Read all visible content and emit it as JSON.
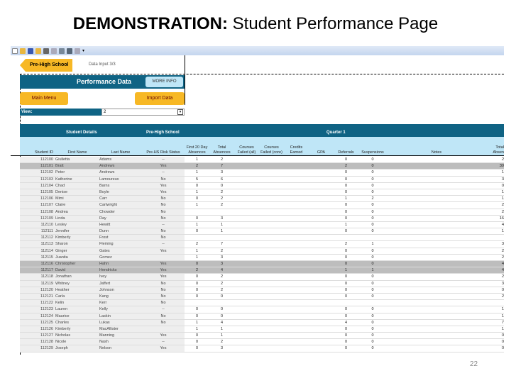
{
  "slide": {
    "title_bold": "DEMONSTRATION:",
    "title_rest": " Student Performance Page",
    "page_number": "22"
  },
  "nav": {
    "pre_high_school": "Pre-High School",
    "data_input": "Data Input 3/3"
  },
  "header": {
    "title": "Performance Data",
    "more_info": "MORE INFO",
    "main_menu": "Main Menu",
    "import_data": "Import Data",
    "view_label": "View:",
    "view_value": "2"
  },
  "groups": {
    "student_details": "Student Details",
    "pre_high_school": "Pre-High School",
    "quarter": "Quarter 1"
  },
  "columns": [
    "Student ID",
    "First Name",
    "Last Name",
    "Pre-HS Risk Status",
    "First 20 Day Absences",
    "Total Absences",
    "Courses Failed (all)",
    "Courses Failed (core)",
    "Credits Earned",
    "GPA",
    "Referrals",
    "Suspensions",
    "Notes",
    "Total Absen"
  ],
  "rows": [
    [
      "112100",
      "Giulietta",
      "Adams",
      "--",
      "1",
      "2",
      "0",
      "0",
      "2",
      false
    ],
    [
      "112101",
      "Bratt",
      "Andrews",
      "Yes",
      "2",
      "7",
      "2",
      "0",
      "30",
      true
    ],
    [
      "112102",
      "Peter",
      "Andrews",
      "--",
      "1",
      "3",
      "0",
      "0",
      "1",
      false
    ],
    [
      "112103",
      "Katherine",
      "Lamoureux",
      "No",
      "5",
      "6",
      "0",
      "0",
      "3",
      false
    ],
    [
      "112104",
      "Chad",
      "Barns",
      "Yes",
      "0",
      "0",
      "0",
      "0",
      "0",
      false
    ],
    [
      "112105",
      "Denise",
      "Boyle",
      "Yes",
      "1",
      "2",
      "0",
      "0",
      "1",
      false
    ],
    [
      "112106",
      "Mimi",
      "Carr",
      "No",
      "0",
      "2",
      "1",
      "2",
      "1",
      false
    ],
    [
      "112107",
      "Claire",
      "Cartwright",
      "No",
      "1",
      "2",
      "0",
      "0",
      "2",
      false
    ],
    [
      "112108",
      "Andrea",
      "Chowder",
      "No",
      "",
      "",
      "0",
      "0",
      "2",
      false
    ],
    [
      "112109",
      "Linda",
      "Day",
      "No",
      "0",
      "3",
      "0",
      "0",
      "16",
      false
    ],
    [
      "112110",
      "Lesley",
      "Hewitt",
      "--",
      "1",
      "1",
      "1",
      "0",
      "4",
      false
    ],
    [
      "112111",
      "Jennifer",
      "Dunn",
      "No",
      "0",
      "1",
      "0",
      "0",
      "1",
      false
    ],
    [
      "112112",
      "Kimberly",
      "Frost",
      "No",
      "",
      "",
      "",
      "",
      "",
      false
    ],
    [
      "112113",
      "Sharon",
      "Fleming",
      "--",
      "2",
      "7",
      "2",
      "1",
      "3",
      false
    ],
    [
      "112114",
      "Ginger",
      "Gates",
      "Yes",
      "1",
      "2",
      "0",
      "0",
      "2",
      false
    ],
    [
      "112115",
      "Juanita",
      "Gomez",
      "",
      "1",
      "3",
      "0",
      "0",
      "2",
      false
    ],
    [
      "112116",
      "Christopher",
      "Hahn",
      "Yes",
      "0",
      "3",
      "0",
      "0",
      "4",
      true
    ],
    [
      "112117",
      "David",
      "Hendricks",
      "Yes",
      "2",
      "4",
      "1",
      "1",
      "4",
      true
    ],
    [
      "112118",
      "Jonathan",
      "Ivey",
      "Yes",
      "0",
      "2",
      "0",
      "0",
      "2",
      false
    ],
    [
      "112119",
      "Whitney",
      "Jaffert",
      "No",
      "0",
      "2",
      "0",
      "0",
      "3",
      false
    ],
    [
      "112120",
      "Heather",
      "Johnson",
      "No",
      "0",
      "2",
      "0",
      "0",
      "0",
      false
    ],
    [
      "112121",
      "Carla",
      "Kang",
      "No",
      "0",
      "0",
      "0",
      "0",
      "2",
      false
    ],
    [
      "112122",
      "Kelin",
      "Kerr",
      "No",
      "",
      "",
      "",
      "",
      "",
      false
    ],
    [
      "112123",
      "Lauren",
      "Kelly",
      "--",
      "0",
      "0",
      "0",
      "0",
      "1",
      false
    ],
    [
      "112124",
      "Maurice",
      "Laskin",
      "No",
      "0",
      "0",
      "0",
      "0",
      "1",
      false
    ],
    [
      "112125",
      "Charles",
      "Lukas",
      "No",
      "1",
      "4",
      "4",
      "0",
      "7",
      false
    ],
    [
      "112126",
      "Kimberly",
      "MacAllister",
      "",
      "1",
      "1",
      "0",
      "0",
      "1",
      false
    ],
    [
      "112127",
      "Nicholas",
      "Manning",
      "Yes",
      "0",
      "1",
      "0",
      "0",
      "0",
      false
    ],
    [
      "112128",
      "Nicole",
      "Nash",
      "--",
      "0",
      "2",
      "0",
      "0",
      "0",
      false
    ],
    [
      "112129",
      "Joseph",
      "Nelson",
      "Yes",
      "0",
      "3",
      "0",
      "0",
      "0",
      false
    ]
  ],
  "colors": {
    "band": "#0f6384",
    "header": "#bfe6f7",
    "button": "#f7b825",
    "highlight": "#bdbdbd"
  }
}
